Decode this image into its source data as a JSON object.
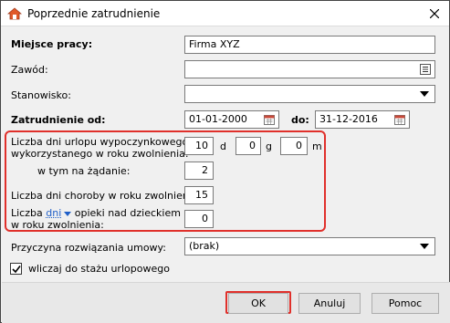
{
  "window": {
    "title": "Poprzednie zatrudnienie",
    "close_label": "×"
  },
  "form": {
    "workplace": {
      "label": "Miejsce pracy:",
      "value": "Firma XYZ"
    },
    "profession": {
      "label": "Zawód:",
      "value": ""
    },
    "position": {
      "label": "Stanowisko:",
      "value": ""
    },
    "employment": {
      "label": "Zatrudnienie od:",
      "from": "01-01-2000",
      "to_label": "do:",
      "to": "31-12-2016"
    },
    "leave": {
      "label_line1": "Liczba dni urlopu wypoczynkowego",
      "label_line2": "wykorzystanego w roku zwolnienia:",
      "days": "10",
      "days_unit": "d",
      "hours": "0",
      "hours_unit": "g",
      "minutes": "0",
      "minutes_unit": "m"
    },
    "on_demand": {
      "label": "w tym na żądanie:",
      "value": "2"
    },
    "sick_days": {
      "label": "Liczba dni choroby w roku zwolnienia:",
      "value": "15"
    },
    "childcare": {
      "label_prefix": "Liczba",
      "unit_link": "dni",
      "label_suffix": "opieki nad dzieckiem",
      "label_line2": "w roku zwolnienia:",
      "value": "0"
    },
    "termination_reason": {
      "label": "Przyczyna rozwiązania umowy:",
      "value": "(brak)"
    },
    "include_in_tenure": {
      "label": "wliczaj do stażu urlopowego",
      "checked": true
    }
  },
  "buttons": {
    "ok": "OK",
    "cancel": "Anuluj",
    "help": "Pomoc"
  },
  "colors": {
    "highlight": "#e0302b",
    "link": "#1f5fc8"
  }
}
